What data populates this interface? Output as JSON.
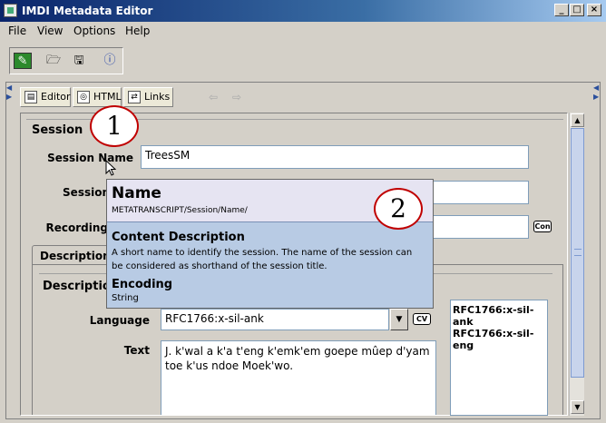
{
  "window": {
    "title": "IMDI Metadata Editor"
  },
  "menu": [
    "File",
    "View",
    "Options",
    "Help"
  ],
  "tabs": [
    {
      "label": "Editor"
    },
    {
      "label": "HTML"
    },
    {
      "label": "Links"
    }
  ],
  "session": {
    "heading": "Session",
    "name_label": "Session Name",
    "name_value": "TreesSM",
    "title_label": "Session",
    "date_label": "Recording",
    "con_button": "Con"
  },
  "descriptions": {
    "tab_label": "Descriptions",
    "heading": "Descriptio",
    "language_label": "Language",
    "language_value": "RFC1766:x-sil-ank",
    "cv_button": "CV",
    "text_label": "Text",
    "text_value": "J. k'wal a k'a t'eng k'emk'em goepe mûep d'yam toe k'us ndoe Moek'wo.",
    "codes": [
      "RFC1766:x-sil-ank",
      "RFC1766:x-sil-eng"
    ]
  },
  "tooltip": {
    "title": "Name",
    "path": "METATRANSCRIPT/Session/Name/",
    "content_heading": "Content Description",
    "content_text": "A short name to identify the session. The name of the session can be considered as shorthand of the session title.",
    "encoding_heading": "Encoding",
    "encoding_value": "String"
  },
  "callouts": [
    "1",
    "2"
  ]
}
